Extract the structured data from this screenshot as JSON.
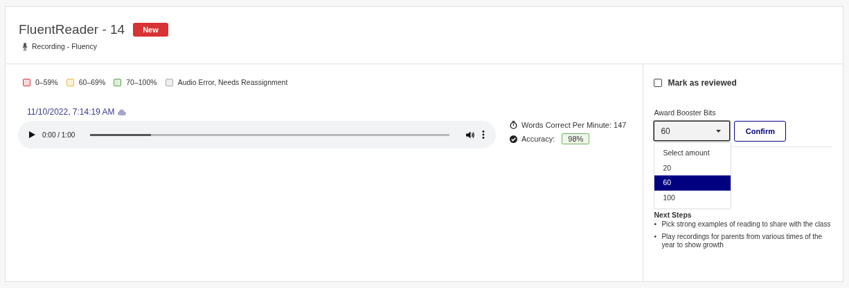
{
  "header": {
    "title": "FluentReader - 14",
    "badge": "New",
    "subtitle": "Recording - Fluency"
  },
  "legend": [
    {
      "label": "0–59%",
      "color": "#d9363e"
    },
    {
      "label": "60–69%",
      "color": "#f0b43c"
    },
    {
      "label": "70–100%",
      "color": "#5aa546"
    },
    {
      "label": "Audio Error, Needs Reassignment",
      "color": "#aaaaaa"
    }
  ],
  "recording": {
    "timestamp": "11/10/2022, 7:14:19 AM",
    "player": {
      "time": "0:00 / 1:00",
      "level": 0.17
    }
  },
  "stats": {
    "wcpm": "Words Correct Per Minute: 147",
    "accuracy_label": "Accuracy:",
    "accuracy": "98%"
  },
  "review": {
    "label": "Mark as reviewed",
    "checked": false
  },
  "award": {
    "label": "Award Booster Bits",
    "value": "60",
    "expanded": true,
    "button": "Confirm",
    "options": [
      {
        "label": "Select amount",
        "selected": false
      },
      {
        "label": "20",
        "selected": false
      },
      {
        "label": "60",
        "selected": true
      },
      {
        "label": "100",
        "selected": false
      }
    ]
  },
  "next_steps": {
    "title": "Next Steps",
    "bullet": "•",
    "items": [
      "Pick strong examples of reading to share with the class",
      "Play recordings for parents from various times of the year to show growth"
    ]
  }
}
